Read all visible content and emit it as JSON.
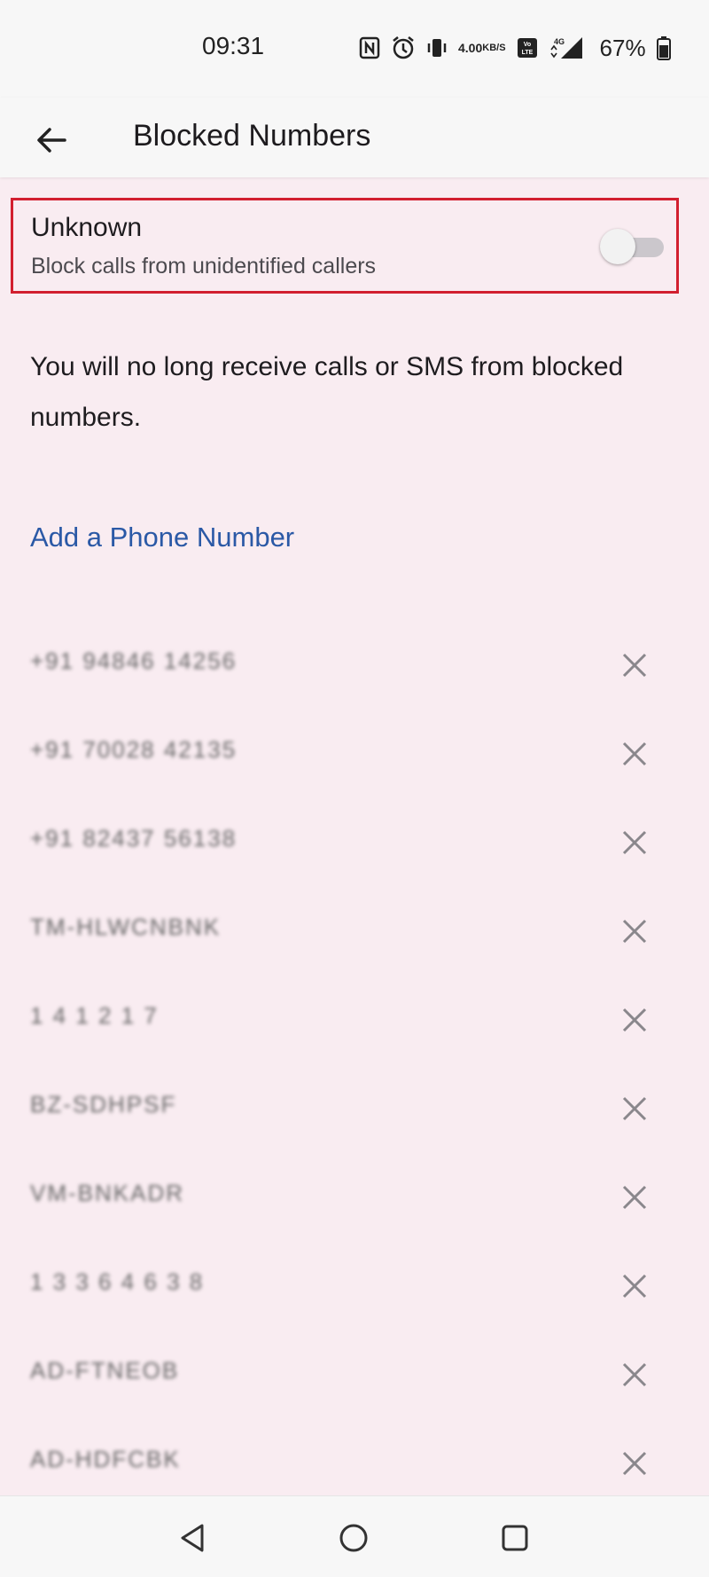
{
  "status_bar": {
    "time": "09:31",
    "net_speed_value": "4.00",
    "net_speed_unit": "KB/S",
    "network": "4G",
    "battery_percent": "67%",
    "icons": [
      "nfc-icon",
      "alarm-icon",
      "vibrate-icon",
      "volte-icon",
      "signal-icon",
      "battery-icon"
    ]
  },
  "app_bar": {
    "title": "Blocked Numbers",
    "back_icon": "arrow-back-icon"
  },
  "unknown_setting": {
    "title": "Unknown",
    "subtitle": "Block calls from unidentified callers",
    "enabled": false,
    "highlight_color": "#d21f2f"
  },
  "info_text": "You will no long receive calls or SMS from blocked numbers.",
  "add_number_label": "Add a Phone Number",
  "blocked_numbers": [
    {
      "number": "+91 94846 14256"
    },
    {
      "number": "+91 70028 42135"
    },
    {
      "number": "+91 82437 56138"
    },
    {
      "number": "TM-HLWCNBNK"
    },
    {
      "number": "1 4 1 2 1 7"
    },
    {
      "number": "BZ-SDHPSF"
    },
    {
      "number": "VM-BNKADR"
    },
    {
      "number": "1 3 3 6 4 6 3 8"
    },
    {
      "number": "AD-FTNEOB"
    },
    {
      "number": "AD-HDFCBK"
    }
  ],
  "colors": {
    "background": "#f9ecf1",
    "link": "#2b59a6",
    "bar": "#f7f7f7"
  },
  "nav": {
    "back_icon": "nav-back-icon",
    "home_icon": "nav-home-icon",
    "recents_icon": "nav-recents-icon"
  }
}
